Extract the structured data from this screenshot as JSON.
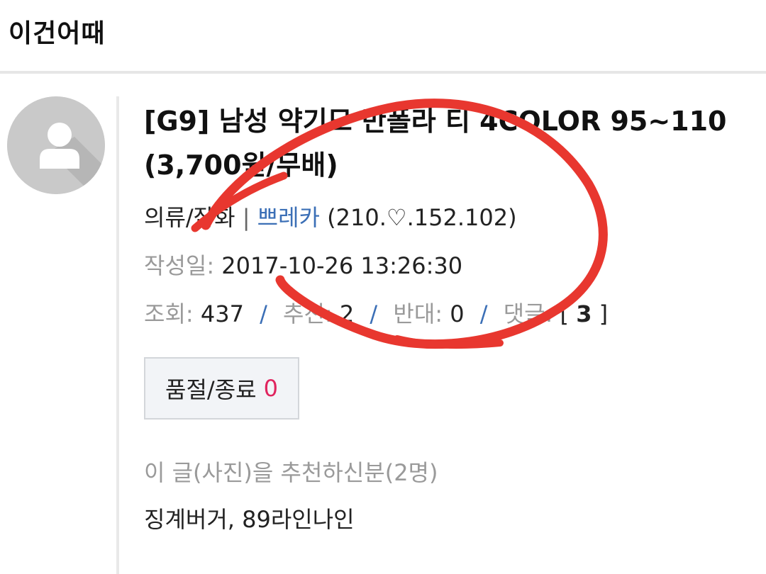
{
  "header": {
    "title": "이건어때"
  },
  "post": {
    "title": "[G9] 남성 약기모 반폴라 티 4COLOR 95~110 (3,700원/무배)",
    "category": "의류/잡화",
    "separator": "|",
    "author": "쁘레카",
    "ip": "(210.♡.152.102)",
    "date_label": "작성일:",
    "date_value": "2017-10-26 13:26:30",
    "stats": {
      "views_label": "조회:",
      "views": "437",
      "recommend_label": "추천:",
      "recommend": "2",
      "oppose_label": "반대:",
      "oppose": "0",
      "comments_label": "댓글:",
      "comments": "3",
      "slash": "/"
    },
    "soldout": {
      "label": "품절/종료",
      "count": "0"
    },
    "recommenders_label": "이 글(사진)을 추천하신분(2명)",
    "recommenders": "징계버거, 89라인나인"
  },
  "icons": {
    "avatar": "default-user-icon"
  },
  "colors": {
    "author": "#3b6fb6",
    "soldout_count": "#e0245e",
    "annotation": "#e8372f"
  }
}
